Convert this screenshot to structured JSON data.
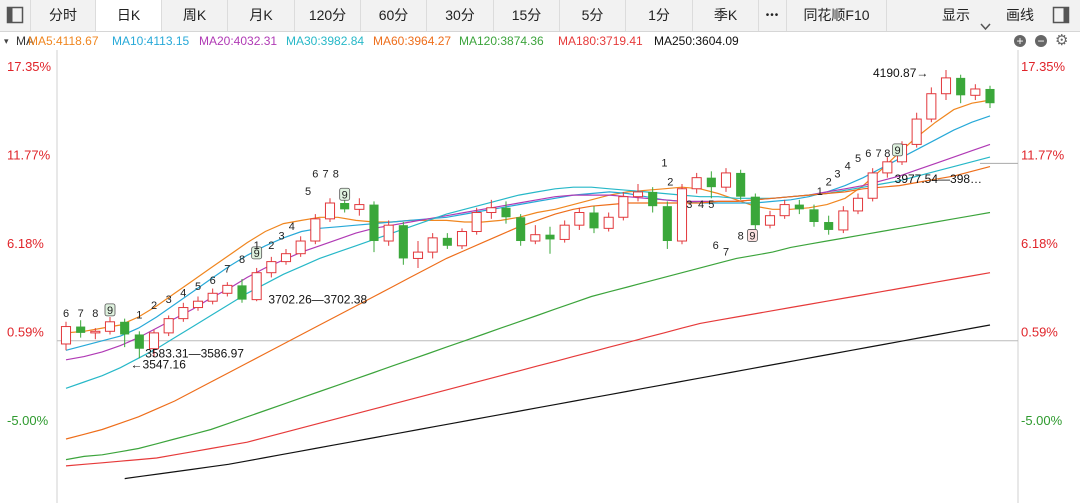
{
  "toolbar": {
    "tabs": [
      {
        "label": "分时"
      },
      {
        "label": "日K"
      },
      {
        "label": "周K"
      },
      {
        "label": "月K"
      },
      {
        "label": "120分"
      },
      {
        "label": "60分"
      },
      {
        "label": "30分"
      },
      {
        "label": "15分"
      },
      {
        "label": "5分"
      },
      {
        "label": "1分"
      },
      {
        "label": "季K"
      },
      {
        "label": "•••"
      },
      {
        "label": "同花顺F10"
      }
    ],
    "active_tab": "日K",
    "display_label": "显示",
    "draw_label": "画线",
    "icons": [
      "sidebar-toggle-icon",
      "chevron-down-icon",
      "panel-toggle-icon",
      "zoom-in-icon",
      "zoom-out-icon",
      "gear-icon"
    ]
  },
  "ma_bar": {
    "label": "MA",
    "items": [
      {
        "text": "MA5:4118.67",
        "color": "#f0861f"
      },
      {
        "text": "MA10:4113.15",
        "color": "#27a9d8"
      },
      {
        "text": "MA20:4032.31",
        "color": "#b03ab5"
      },
      {
        "text": "MA30:3982.84",
        "color": "#27b8c8"
      },
      {
        "text": "MA60:3964.27",
        "color": "#ee6e1b"
      },
      {
        "text": "MA120:3874.36",
        "color": "#3ca43c"
      },
      {
        "text": "MA180:3719.41",
        "color": "#e63a3a"
      },
      {
        "text": "MA250:3604.09",
        "color": "#111111"
      }
    ]
  },
  "chart_data": {
    "type": "candlestick",
    "y_axis_labels": [
      "17.35%",
      "11.77%",
      "6.18%",
      "0.59%",
      "-5.00%"
    ],
    "y_axis_values": [
      17.35,
      11.77,
      6.18,
      0.59,
      -5.0
    ],
    "ylim": [
      -9.5,
      19.6
    ],
    "reference_line_pct": 0.0,
    "n_bars": 64,
    "candles": [
      {
        "o": -0.2,
        "c": 0.9,
        "h": 1.2,
        "l": -0.6
      },
      {
        "o": 0.9,
        "c": 0.5,
        "h": 1.3,
        "l": 0.2
      },
      {
        "o": 0.5,
        "c": 0.6,
        "h": 0.8,
        "l": 0.1
      },
      {
        "o": 0.6,
        "c": 1.2,
        "h": 1.5,
        "l": 0.4
      },
      {
        "o": 1.2,
        "c": 0.4,
        "h": 1.4,
        "l": -0.4
      },
      {
        "o": 0.4,
        "c": -0.5,
        "h": 0.6,
        "l": -1.1
      },
      {
        "o": -0.5,
        "c": 0.5,
        "h": 0.7,
        "l": -1.0
      },
      {
        "o": 0.5,
        "c": 1.4,
        "h": 1.6,
        "l": 0.3
      },
      {
        "o": 1.4,
        "c": 2.1,
        "h": 2.4,
        "l": 1.2
      },
      {
        "o": 2.1,
        "c": 2.5,
        "h": 2.8,
        "l": 1.9
      },
      {
        "o": 2.5,
        "c": 3.0,
        "h": 3.3,
        "l": 2.3
      },
      {
        "o": 3.0,
        "c": 3.5,
        "h": 3.7,
        "l": 2.8
      },
      {
        "o": 3.5,
        "c": 2.6,
        "h": 3.9,
        "l": 2.4
      },
      {
        "o": 2.6,
        "c": 4.3,
        "h": 4.6,
        "l": 2.5
      },
      {
        "o": 4.3,
        "c": 5.0,
        "h": 5.3,
        "l": 4.0
      },
      {
        "o": 5.0,
        "c": 5.5,
        "h": 5.8,
        "l": 4.8
      },
      {
        "o": 5.5,
        "c": 6.3,
        "h": 6.6,
        "l": 5.3
      },
      {
        "o": 6.3,
        "c": 7.7,
        "h": 8.0,
        "l": 6.1
      },
      {
        "o": 7.7,
        "c": 8.7,
        "h": 9.0,
        "l": 7.5
      },
      {
        "o": 8.7,
        "c": 8.3,
        "h": 9.3,
        "l": 8.1
      },
      {
        "o": 8.3,
        "c": 8.6,
        "h": 9.0,
        "l": 7.9
      },
      {
        "o": 8.6,
        "c": 6.3,
        "h": 8.8,
        "l": 5.6
      },
      {
        "o": 6.3,
        "c": 7.3,
        "h": 7.6,
        "l": 6.0
      },
      {
        "o": 7.3,
        "c": 5.2,
        "h": 7.5,
        "l": 4.8
      },
      {
        "o": 5.2,
        "c": 5.6,
        "h": 6.3,
        "l": 4.6
      },
      {
        "o": 5.6,
        "c": 6.5,
        "h": 6.8,
        "l": 5.2
      },
      {
        "o": 6.5,
        "c": 6.0,
        "h": 6.8,
        "l": 5.8
      },
      {
        "o": 6.0,
        "c": 6.9,
        "h": 7.1,
        "l": 5.8
      },
      {
        "o": 6.9,
        "c": 8.1,
        "h": 8.4,
        "l": 6.7
      },
      {
        "o": 8.1,
        "c": 8.4,
        "h": 8.9,
        "l": 7.7
      },
      {
        "o": 8.4,
        "c": 7.8,
        "h": 8.8,
        "l": 7.4
      },
      {
        "o": 7.8,
        "c": 6.3,
        "h": 8.0,
        "l": 6.0
      },
      {
        "o": 6.3,
        "c": 6.7,
        "h": 7.3,
        "l": 6.1
      },
      {
        "o": 6.7,
        "c": 6.4,
        "h": 7.2,
        "l": 5.5
      },
      {
        "o": 6.4,
        "c": 7.3,
        "h": 7.6,
        "l": 6.2
      },
      {
        "o": 7.3,
        "c": 8.1,
        "h": 8.4,
        "l": 7.0
      },
      {
        "o": 8.1,
        "c": 7.1,
        "h": 8.5,
        "l": 6.8
      },
      {
        "o": 7.1,
        "c": 7.8,
        "h": 8.1,
        "l": 6.9
      },
      {
        "o": 7.8,
        "c": 9.1,
        "h": 9.4,
        "l": 7.6
      },
      {
        "o": 9.1,
        "c": 9.4,
        "h": 9.9,
        "l": 8.8
      },
      {
        "o": 9.4,
        "c": 8.5,
        "h": 9.7,
        "l": 8.1
      },
      {
        "o": 8.5,
        "c": 6.3,
        "h": 8.8,
        "l": 5.8
      },
      {
        "o": 6.3,
        "c": 9.6,
        "h": 9.9,
        "l": 6.1
      },
      {
        "o": 9.6,
        "c": 10.3,
        "h": 10.6,
        "l": 9.3
      },
      {
        "o": 10.3,
        "c": 9.7,
        "h": 10.7,
        "l": 9.0
      },
      {
        "o": 9.7,
        "c": 10.6,
        "h": 10.9,
        "l": 9.4
      },
      {
        "o": 10.6,
        "c": 9.1,
        "h": 10.8,
        "l": 8.9
      },
      {
        "o": 9.1,
        "c": 7.3,
        "h": 9.3,
        "l": 6.8
      },
      {
        "o": 7.3,
        "c": 7.9,
        "h": 8.2,
        "l": 7.1
      },
      {
        "o": 7.9,
        "c": 8.6,
        "h": 8.9,
        "l": 7.7
      },
      {
        "o": 8.6,
        "c": 8.3,
        "h": 8.9,
        "l": 8.0
      },
      {
        "o": 8.3,
        "c": 7.5,
        "h": 8.6,
        "l": 7.2
      },
      {
        "o": 7.5,
        "c": 7.0,
        "h": 7.9,
        "l": 6.7
      },
      {
        "o": 7.0,
        "c": 8.2,
        "h": 8.5,
        "l": 6.8
      },
      {
        "o": 8.2,
        "c": 9.0,
        "h": 9.3,
        "l": 8.0
      },
      {
        "o": 9.0,
        "c": 10.6,
        "h": 10.9,
        "l": 8.8
      },
      {
        "o": 10.6,
        "c": 11.3,
        "h": 11.6,
        "l": 10.3
      },
      {
        "o": 11.3,
        "c": 12.4,
        "h": 12.6,
        "l": 11.1
      },
      {
        "o": 12.4,
        "c": 14.0,
        "h": 14.4,
        "l": 12.2
      },
      {
        "o": 14.0,
        "c": 15.6,
        "h": 16.0,
        "l": 13.8
      },
      {
        "o": 15.6,
        "c": 16.6,
        "h": 17.1,
        "l": 15.2
      },
      {
        "o": 16.6,
        "c": 15.5,
        "h": 16.8,
        "l": 15.0
      },
      {
        "o": 15.5,
        "c": 15.9,
        "h": 16.2,
        "l": 15.2
      },
      {
        "o": 15.9,
        "c": 15.0,
        "h": 16.1,
        "l": 14.7
      }
    ],
    "ma_series": [
      {
        "name": "MA5",
        "color": "#f0861f",
        "values": [
          0.5,
          0.6,
          0.8,
          1.0,
          1.5,
          2.2,
          3.0,
          3.8,
          4.6,
          5.4,
          6.2,
          6.9,
          7.4,
          7.6,
          7.8,
          7.8,
          7.6,
          7.5,
          7.5,
          7.6,
          7.6,
          7.6,
          7.5,
          7.5,
          7.6,
          7.8,
          8.1,
          8.3,
          8.6,
          8.9,
          9.2,
          9.4,
          9.5,
          9.6,
          9.7,
          9.6,
          9.3,
          8.9,
          8.5,
          8.3,
          8.3,
          8.4,
          8.6,
          9.0,
          9.8,
          10.8,
          11.9,
          12.9,
          13.8,
          14.6,
          15.0,
          15.2
        ]
      },
      {
        "name": "MA10",
        "color": "#27a9d8",
        "values": [
          -0.6,
          -0.3,
          0.0,
          0.3,
          0.8,
          1.5,
          2.3,
          3.1,
          3.9,
          4.7,
          5.4,
          6.0,
          6.5,
          6.9,
          7.1,
          7.2,
          7.3,
          7.4,
          7.5,
          7.6,
          7.7,
          7.8,
          8.0,
          8.2,
          8.4,
          8.6,
          8.8,
          9.0,
          9.2,
          9.3,
          9.4,
          9.3,
          9.1,
          8.9,
          8.8,
          8.7,
          8.7,
          8.7,
          8.7,
          8.8,
          8.9,
          9.1,
          9.4,
          9.8,
          10.3,
          10.9,
          11.5,
          12.1,
          12.7,
          13.3,
          13.8,
          14.2
        ]
      },
      {
        "name": "MA20",
        "color": "#b03ab5",
        "values": [
          -1.2,
          -1.0,
          -0.7,
          -0.3,
          0.2,
          0.8,
          1.4,
          2.0,
          2.7,
          3.3,
          4.0,
          4.6,
          5.1,
          5.6,
          6.0,
          6.4,
          6.8,
          7.1,
          7.3,
          7.5,
          7.7,
          7.9,
          8.1,
          8.3,
          8.5,
          8.7,
          8.9,
          9.1,
          9.2,
          9.2,
          9.2,
          9.1,
          9.0,
          8.9,
          8.8,
          8.8,
          8.8,
          8.8,
          8.9,
          9.0,
          9.1,
          9.2,
          9.4,
          9.6,
          9.8,
          10.1,
          10.4,
          10.8,
          11.2,
          11.6,
          12.0,
          12.4
        ]
      },
      {
        "name": "MA30",
        "color": "#27b8c8",
        "values": [
          -3.0,
          -2.6,
          -2.2,
          -1.7,
          -1.1,
          -0.5,
          0.2,
          0.9,
          1.6,
          2.3,
          3.0,
          3.6,
          4.2,
          4.7,
          5.2,
          5.6,
          6.0,
          6.4,
          6.8,
          7.2,
          7.6,
          8.0,
          8.3,
          8.6,
          8.9,
          9.2,
          9.4,
          9.6,
          9.7,
          9.7,
          9.6,
          9.5,
          9.4,
          9.3,
          9.2,
          9.1,
          9.1,
          9.0,
          9.0,
          9.0,
          9.1,
          9.2,
          9.3,
          9.5,
          9.7,
          9.9,
          10.1,
          10.4,
          10.7,
          11.0,
          11.3,
          11.6
        ]
      },
      {
        "name": "MA60",
        "color": "#ee6e1b",
        "values": [
          -6.2,
          -5.9,
          -5.6,
          -5.2,
          -4.8,
          -4.3,
          -3.8,
          -3.2,
          -2.6,
          -2.0,
          -1.4,
          -0.8,
          -0.2,
          0.4,
          1.0,
          1.6,
          2.2,
          2.8,
          3.4,
          4.0,
          4.6,
          5.2,
          5.7,
          6.2,
          6.7,
          7.2,
          7.6,
          8.0,
          8.3,
          8.5,
          8.6,
          8.7,
          8.7,
          8.7,
          8.7,
          8.7,
          8.8,
          8.8,
          8.9,
          9.0,
          9.1,
          9.2,
          9.3,
          9.4,
          9.6,
          9.7,
          9.8,
          10.0,
          10.2,
          10.4,
          10.7,
          11.0
        ]
      },
      {
        "name": "MA120",
        "color": "#3ca43c",
        "values": [
          -7.5,
          -7.3,
          -7.2,
          -7.0,
          -6.8,
          -6.5,
          -6.2,
          -5.9,
          -5.6,
          -5.2,
          -4.8,
          -4.4,
          -4.0,
          -3.6,
          -3.2,
          -2.8,
          -2.4,
          -2.0,
          -1.6,
          -1.2,
          -0.8,
          -0.4,
          0.0,
          0.4,
          0.8,
          1.2,
          1.6,
          2.0,
          2.4,
          2.8,
          3.1,
          3.4,
          3.7,
          4.0,
          4.3,
          4.6,
          4.9,
          5.2,
          5.4,
          5.6,
          5.9,
          6.1,
          6.3,
          6.5,
          6.7,
          6.9,
          7.1,
          7.3,
          7.5,
          7.7,
          7.9,
          8.1
        ]
      },
      {
        "name": "MA180",
        "color": "#e63a3a",
        "values": [
          -7.9,
          -7.8,
          -7.7,
          -7.6,
          -7.5,
          -7.4,
          -7.2,
          -7.0,
          -6.8,
          -6.6,
          -6.4,
          -6.1,
          -5.8,
          -5.5,
          -5.2,
          -4.9,
          -4.6,
          -4.3,
          -4.0,
          -3.7,
          -3.4,
          -3.1,
          -2.8,
          -2.5,
          -2.2,
          -1.9,
          -1.6,
          -1.3,
          -1.0,
          -0.7,
          -0.4,
          -0.1,
          0.2,
          0.5,
          0.8,
          1.1,
          1.3,
          1.5,
          1.7,
          1.9,
          2.1,
          2.3,
          2.5,
          2.7,
          2.9,
          3.1,
          3.3,
          3.5,
          3.7,
          3.9,
          4.1,
          4.3
        ]
      },
      {
        "name": "MA250",
        "color": "#111111",
        "start": 4,
        "values": [
          -8.7,
          -8.55,
          -8.4,
          -8.25,
          -8.1,
          -7.95,
          -7.8,
          -7.6,
          -7.4,
          -7.2,
          -7.0,
          -6.8,
          -6.6,
          -6.4,
          -6.2,
          -6.0,
          -5.8,
          -5.6,
          -5.4,
          -5.2,
          -5.0,
          -4.8,
          -4.6,
          -4.4,
          -4.2,
          -4.0,
          -3.8,
          -3.6,
          -3.4,
          -3.2,
          -3.0,
          -2.8,
          -2.6,
          -2.4,
          -2.2,
          -2.0,
          -1.8,
          -1.6,
          -1.4,
          -1.2,
          -1.0,
          -0.8,
          -0.6,
          -0.4,
          -0.2,
          0.0,
          0.2,
          0.4,
          0.6,
          0.8,
          1.0
        ]
      }
    ],
    "annotations": [
      {
        "text": "4190.87→",
        "bar": 58.8,
        "pct": 16.9,
        "anchor": "end"
      },
      {
        "text": "3702.26—3702.38",
        "bar": 13.8,
        "pct": 2.6,
        "anchor": "start"
      },
      {
        "text": "3583.31—3586.97",
        "bar": 5.4,
        "pct": -0.8,
        "anchor": "start"
      },
      {
        "text": "←3547.16",
        "bar": 4.4,
        "pct": -1.5,
        "anchor": "start"
      },
      {
        "text": "3977.54—398…",
        "bar": 56.5,
        "pct": 10.2,
        "anchor": "start"
      }
    ],
    "count_labels": [
      {
        "text": "6",
        "bar": 0,
        "pct": 1.5
      },
      {
        "text": "7",
        "bar": 1,
        "pct": 1.5
      },
      {
        "text": "8",
        "bar": 2,
        "pct": 1.5
      },
      {
        "text": "9",
        "bar": 3,
        "pct": 1.7,
        "boxed": true
      },
      {
        "text": "1",
        "bar": 5,
        "pct": 1.4
      },
      {
        "text": "2",
        "bar": 6,
        "pct": 2.0
      },
      {
        "text": "3",
        "bar": 7,
        "pct": 2.4
      },
      {
        "text": "4",
        "bar": 8,
        "pct": 2.8
      },
      {
        "text": "5",
        "bar": 9,
        "pct": 3.2
      },
      {
        "text": "6",
        "bar": 10,
        "pct": 3.6
      },
      {
        "text": "7",
        "bar": 11,
        "pct": 4.3
      },
      {
        "text": "8",
        "bar": 12,
        "pct": 4.9
      },
      {
        "text": "9",
        "bar": 13,
        "pct": 5.3,
        "boxed": true
      },
      {
        "text": "1",
        "bar": 13,
        "pct": 5.8
      },
      {
        "text": "2",
        "bar": 14,
        "pct": 5.8
      },
      {
        "text": "3",
        "bar": 14.7,
        "pct": 6.4
      },
      {
        "text": "4",
        "bar": 15.4,
        "pct": 7.0
      },
      {
        "text": "5",
        "bar": 16.5,
        "pct": 9.2
      },
      {
        "text": "6",
        "bar": 17,
        "pct": 10.3
      },
      {
        "text": "7",
        "bar": 17.7,
        "pct": 10.3
      },
      {
        "text": "8",
        "bar": 18.4,
        "pct": 10.3
      },
      {
        "text": "9",
        "bar": 19,
        "pct": 9.0,
        "boxed": true
      },
      {
        "text": "1",
        "bar": 40.8,
        "pct": 11.0
      },
      {
        "text": "2",
        "bar": 41.2,
        "pct": 9.8
      },
      {
        "text": "3",
        "bar": 42.5,
        "pct": 8.4
      },
      {
        "text": "4",
        "bar": 43.3,
        "pct": 8.4
      },
      {
        "text": "5",
        "bar": 44,
        "pct": 8.4
      },
      {
        "text": "6",
        "bar": 44.3,
        "pct": 5.8
      },
      {
        "text": "7",
        "bar": 45,
        "pct": 5.4
      },
      {
        "text": "8",
        "bar": 46,
        "pct": 6.4
      },
      {
        "text": "9",
        "bar": 46.8,
        "pct": 6.4,
        "boxed": true,
        "red": true
      },
      {
        "text": "1",
        "bar": 51.4,
        "pct": 9.2
      },
      {
        "text": "2",
        "bar": 52,
        "pct": 9.8
      },
      {
        "text": "3",
        "bar": 52.6,
        "pct": 10.3
      },
      {
        "text": "4",
        "bar": 53.3,
        "pct": 10.8
      },
      {
        "text": "5",
        "bar": 54,
        "pct": 11.3
      },
      {
        "text": "6",
        "bar": 54.7,
        "pct": 11.6
      },
      {
        "text": "7",
        "bar": 55.4,
        "pct": 11.6
      },
      {
        "text": "8",
        "bar": 56,
        "pct": 11.6
      },
      {
        "text": "9",
        "bar": 56.7,
        "pct": 11.8,
        "boxed": true
      }
    ]
  }
}
